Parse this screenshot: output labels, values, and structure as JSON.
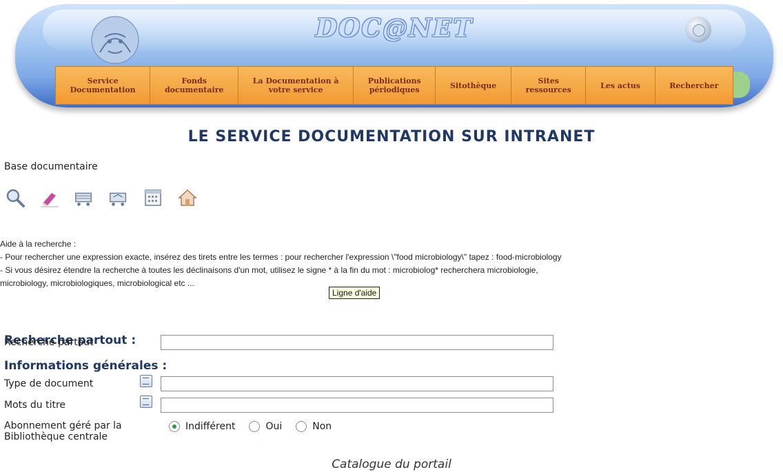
{
  "banner": {
    "logo": "DOC@NET",
    "nav": [
      {
        "line1": "Service",
        "line2": "Documentation"
      },
      {
        "line1": "Fonds",
        "line2": "documentaire"
      },
      {
        "line1": "La Documentation à",
        "line2": "votre service"
      },
      {
        "line1": "Publications",
        "line2": "périodiques"
      },
      {
        "line1": "Sitothèque",
        "line2": ""
      },
      {
        "line1": "Sites",
        "line2": "ressources"
      },
      {
        "line1": "Les actus",
        "line2": ""
      },
      {
        "line1": "Rechercher",
        "line2": ""
      }
    ]
  },
  "page": {
    "title": "LE SERVICE DOCUMENTATION SUR INTRANET",
    "base_label": "Base documentaire",
    "toolbar_icons": [
      "search-icon",
      "eraser-icon",
      "cart-icon",
      "cart-transfer-icon",
      "calendar-icon",
      "home-icon"
    ]
  },
  "help": {
    "heading": "Aide à la recherche :",
    "line1": "- Pour rechercher une expression exacte, insérez des tirets entre les termes : pour rechercher l'expression \\\"food microbiology\\\" tapez : food-microbiology",
    "line2": "- Si vous désirez étendre la recherche à toutes les déclinaisons d'un mot, utilisez le signe * à la fin du mot : microbiolog* recherchera microbiologie,",
    "line3": "microbiology, microbiologiques, microbiological etc ...",
    "tooltip": "Ligne d'aide"
  },
  "form": {
    "section1": "Recherche partout :",
    "field_partout_label": "Recherche partout",
    "field_partout_value": "",
    "section2": "Informations générales :",
    "field_type_label": "Type de document",
    "field_type_value": "",
    "field_titre_label": "Mots du titre",
    "field_titre_value": "",
    "abonnement_label_1": "Abonnement géré par la",
    "abonnement_label_2": "Bibliothèque centrale",
    "radio_options": [
      "Indifférent",
      "Oui",
      "Non"
    ],
    "radio_selected": "Indifférent"
  },
  "caption": "Catalogue du portail",
  "colors": {
    "nav_bg": "#f4a541",
    "nav_text": "#7a2e1a",
    "title": "#1f3864",
    "banner_blue": "#7fa9e6"
  }
}
